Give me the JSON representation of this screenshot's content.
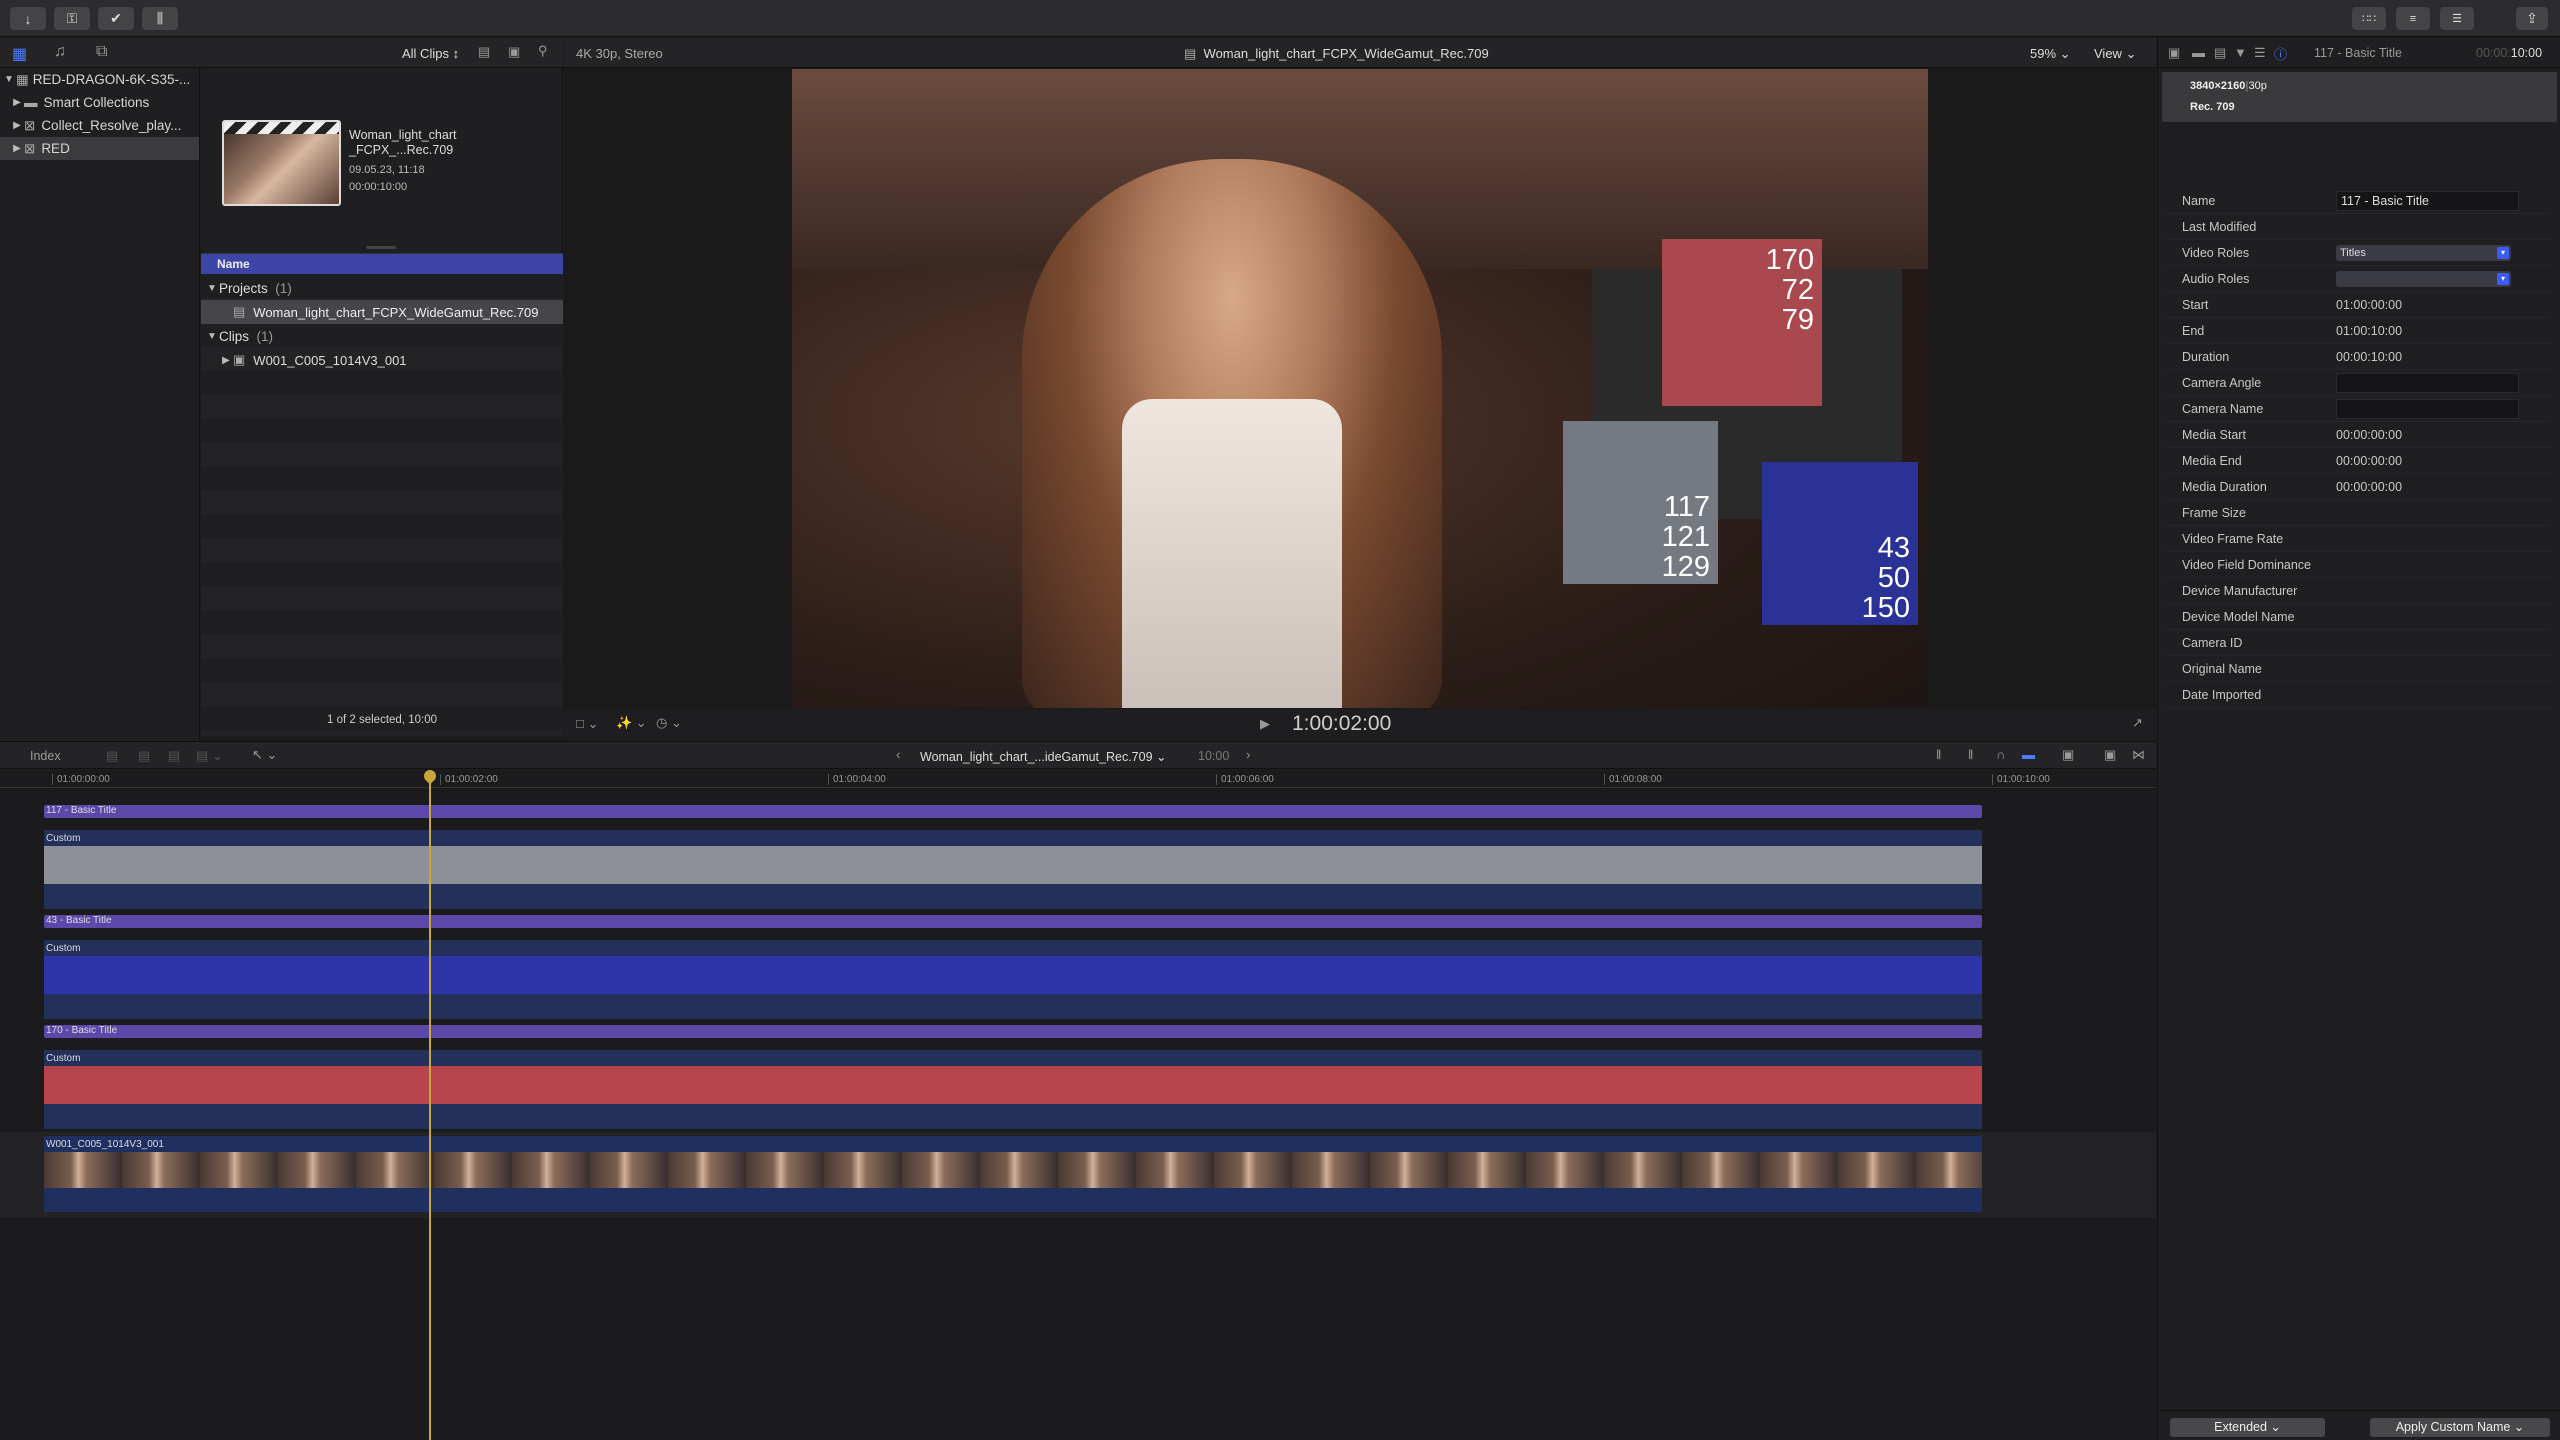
{
  "toolbar": {
    "import_icon": "download-arrow-icon",
    "keywords_icon": "key-icon",
    "check_icon": "checkmark-circle-icon",
    "audio_icon": "waveform-icon",
    "share_icon": "share-icon"
  },
  "library": {
    "items": [
      {
        "label": "RED-DRAGON-6K-S35-...",
        "level": 0,
        "expanded": true
      },
      {
        "label": "Smart Collections",
        "level": 1,
        "expanded": false
      },
      {
        "label": "Collect_Resolve_play...",
        "level": 1,
        "expanded": false
      },
      {
        "label": "RED",
        "level": 1,
        "expanded": false,
        "selected": true
      }
    ]
  },
  "browser": {
    "filter": "All Clips",
    "thumb_title": "Woman_light_chart _FCPX_...Rec.709",
    "thumb_title_line1": "Woman_light_chart",
    "thumb_title_line2": "_FCPX_...Rec.709",
    "thumb_date": "09.05.23, 11:18",
    "thumb_duration": "00:00:10:00",
    "column_name": "Name",
    "group_projects": "Projects",
    "group_projects_count": "(1)",
    "project_item": "Woman_light_chart_FCPX_WideGamut_Rec.709",
    "group_clips": "Clips",
    "group_clips_count": "(1)",
    "clip_item": "W001_C005_1014V3_001",
    "status": "1 of 2 selected, 10:00"
  },
  "viewer": {
    "format": "4K 30p, Stereo",
    "title": "Woman_light_chart_FCPX_WideGamut_Rec.709",
    "zoom": "59%",
    "view_menu": "View",
    "timecode": "1:00:02:00",
    "swatches": {
      "red": [
        "170",
        "72",
        "79"
      ],
      "gray": [
        "117",
        "121",
        "129"
      ],
      "blue": [
        "43",
        "50",
        "150"
      ]
    },
    "colors": {
      "red": "#aa4850",
      "gray": "#757981",
      "blue": "#2b3296"
    }
  },
  "inspector": {
    "title": "117 - Basic Title",
    "time": "10:00",
    "time_dim": "00:00:",
    "resolution": "3840×2160",
    "framerate": "30p",
    "colorspace": "Rec. 709",
    "rows": [
      {
        "key": "Name",
        "value": "117 - Basic Title",
        "type": "field"
      },
      {
        "key": "Last Modified",
        "value": "",
        "type": "text"
      },
      {
        "key": "Video Roles",
        "value": "Titles",
        "type": "dropdown"
      },
      {
        "key": "Audio Roles",
        "value": "",
        "type": "dropdown"
      },
      {
        "key": "Start",
        "value": "01:00:00:00",
        "type": "text"
      },
      {
        "key": "End",
        "value": "01:00:10:00",
        "type": "text"
      },
      {
        "key": "Duration",
        "value": "00:00:10:00",
        "type": "text"
      },
      {
        "key": "Camera Angle",
        "value": "",
        "type": "field"
      },
      {
        "key": "Camera Name",
        "value": "",
        "type": "field"
      },
      {
        "key": "Media Start",
        "value": "00:00:00:00",
        "type": "text"
      },
      {
        "key": "Media End",
        "value": "00:00:00:00",
        "type": "text"
      },
      {
        "key": "Media Duration",
        "value": "00:00:00:00",
        "type": "text"
      },
      {
        "key": "Frame Size",
        "value": "",
        "type": "text"
      },
      {
        "key": "Video Frame Rate",
        "value": "",
        "type": "text"
      },
      {
        "key": "Video Field Dominance",
        "value": "",
        "type": "text"
      },
      {
        "key": "Device Manufacturer",
        "value": "",
        "type": "text"
      },
      {
        "key": "Device Model Name",
        "value": "",
        "type": "text"
      },
      {
        "key": "Camera ID",
        "value": "",
        "type": "text"
      },
      {
        "key": "Original Name",
        "value": "",
        "type": "text"
      },
      {
        "key": "Date Imported",
        "value": "",
        "type": "text"
      }
    ],
    "footer_left": "Extended",
    "footer_right": "Apply Custom Name"
  },
  "timeline": {
    "index_label": "Index",
    "project_name": "Woman_light_chart_...ideGamut_Rec.709",
    "project_duration": "10:00",
    "ruler": [
      "01:00:00:00",
      "01:00:02:00",
      "01:00:04:00",
      "01:00:06:00",
      "01:00:08:00",
      "01:00:10:00"
    ],
    "playhead_fraction": 0.2,
    "tracks": [
      {
        "title": "117 - Basic Title",
        "effect": "Custom",
        "color": "#8d9096"
      },
      {
        "title": "43 - Basic Title",
        "effect": "Custom",
        "color": "#2e35a8"
      },
      {
        "title": "170 - Basic Title",
        "effect": "Custom",
        "color": "#b8444e"
      }
    ],
    "video_clip": "W001_C005_1014V3_001"
  }
}
